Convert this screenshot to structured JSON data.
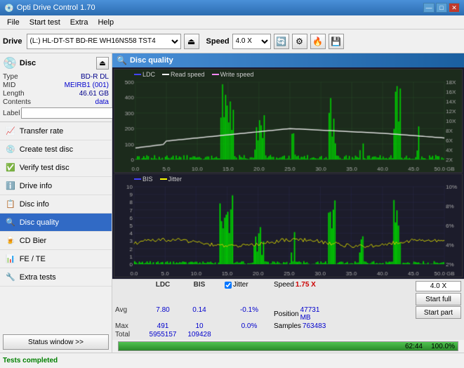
{
  "app": {
    "title": "Opti Drive Control 1.70",
    "icon": "💿"
  },
  "titlebar": {
    "title": "Opti Drive Control 1.70",
    "minimize": "—",
    "maximize": "□",
    "close": "✕"
  },
  "menubar": {
    "items": [
      "File",
      "Start test",
      "Extra",
      "Help"
    ]
  },
  "toolbar": {
    "drive_label": "Drive",
    "drive_value": "(L:)  HL-DT-ST BD-RE  WH16NS58 TST4",
    "speed_label": "Speed",
    "speed_value": "4.0 X"
  },
  "disc": {
    "title": "Disc",
    "type_label": "Type",
    "type_value": "BD-R DL",
    "mid_label": "MID",
    "mid_value": "MEIRB1 (001)",
    "length_label": "Length",
    "length_value": "46.61 GB",
    "contents_label": "Contents",
    "contents_value": "data",
    "label_label": "Label",
    "label_value": ""
  },
  "nav": {
    "items": [
      {
        "id": "transfer-rate",
        "label": "Transfer rate",
        "icon": "📈"
      },
      {
        "id": "create-test-disc",
        "label": "Create test disc",
        "icon": "💿"
      },
      {
        "id": "verify-test-disc",
        "label": "Verify test disc",
        "icon": "✅"
      },
      {
        "id": "drive-info",
        "label": "Drive info",
        "icon": "ℹ️"
      },
      {
        "id": "disc-info",
        "label": "Disc info",
        "icon": "📋"
      },
      {
        "id": "disc-quality",
        "label": "Disc quality",
        "icon": "🔍",
        "active": true
      },
      {
        "id": "cd-bier",
        "label": "CD Bier",
        "icon": "🍺"
      },
      {
        "id": "fe-te",
        "label": "FE / TE",
        "icon": "📊"
      },
      {
        "id": "extra-tests",
        "label": "Extra tests",
        "icon": "🔧"
      }
    ]
  },
  "status_window_btn": "Status window >>",
  "quality": {
    "title": "Disc quality",
    "chart1": {
      "legend": [
        "LDC",
        "Read speed",
        "Write speed"
      ],
      "y_max": 500,
      "y_right_max": 18,
      "y_right_labels": [
        "18X",
        "16X",
        "14X",
        "12X",
        "10X",
        "8X",
        "6X",
        "4X",
        "2X"
      ],
      "x_labels": [
        "0.0",
        "5.0",
        "10.0",
        "15.0",
        "20.0",
        "25.0",
        "30.0",
        "35.0",
        "40.0",
        "45.0",
        "50.0 GB"
      ],
      "y_labels": [
        "500",
        "400",
        "300",
        "200",
        "100",
        "0.0"
      ]
    },
    "chart2": {
      "legend": [
        "BIS",
        "Jitter"
      ],
      "y_max": 10,
      "y_right_max": 10,
      "y_right_labels": [
        "10%",
        "8%",
        "6%",
        "4%",
        "2%"
      ],
      "y_labels": [
        "10",
        "9",
        "8",
        "7",
        "6",
        "5",
        "4",
        "3",
        "2",
        "1"
      ],
      "x_labels": [
        "0.0",
        "5.0",
        "10.0",
        "15.0",
        "20.0",
        "25.0",
        "30.0",
        "35.0",
        "40.0",
        "45.0",
        "50.0 GB"
      ]
    }
  },
  "stats": {
    "col_headers": [
      "",
      "LDC",
      "BIS",
      "",
      "Jitter",
      "Speed",
      ""
    ],
    "avg_label": "Avg",
    "avg_ldc": "7.80",
    "avg_bis": "0.14",
    "avg_jitter": "-0.1%",
    "max_label": "Max",
    "max_ldc": "491",
    "max_bis": "10",
    "max_jitter": "0.0%",
    "total_label": "Total",
    "total_ldc": "5955157",
    "total_bis": "109428",
    "jitter_checked": true,
    "jitter_label": "Jitter",
    "speed_label": "Speed",
    "speed_value": "1.75 X",
    "speed_box_value": "4.0 X",
    "position_label": "Position",
    "position_value": "47731 MB",
    "samples_label": "Samples",
    "samples_value": "763483",
    "btn_start_full": "Start full",
    "btn_start_part": "Start part"
  },
  "progress": {
    "percent": 100,
    "percent_text": "100.0%",
    "time": "62:44"
  },
  "statusbar": {
    "text": "Tests completed",
    "icon": "✅"
  }
}
